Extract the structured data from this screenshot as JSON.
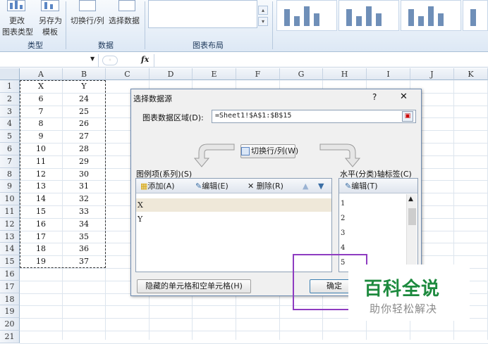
{
  "ribbon": {
    "type_group": {
      "label": "类型",
      "change_type_line1": "更改",
      "change_type_line2": "图表类型",
      "save_template_line1": "另存为",
      "save_template_line2": "模板"
    },
    "data_group": {
      "label": "数据",
      "switch_row_col": "切换行/列",
      "select_data": "选择数据"
    },
    "layout_group": {
      "label": "图表布局"
    }
  },
  "formula_bar": {
    "name_box_value": "",
    "fx": "fx",
    "formula_value": ""
  },
  "grid": {
    "columns": [
      "A",
      "B",
      "C",
      "D",
      "E",
      "F",
      "G",
      "H",
      "I",
      "J",
      "K"
    ],
    "rows": [
      "1",
      "2",
      "3",
      "4",
      "5",
      "6",
      "7",
      "8",
      "9",
      "10",
      "11",
      "12",
      "13",
      "14",
      "15",
      "16",
      "17",
      "18",
      "19",
      "20",
      "21"
    ],
    "col_a": [
      "X",
      "6",
      "7",
      "8",
      "9",
      "10",
      "11",
      "12",
      "13",
      "14",
      "15",
      "16",
      "17",
      "18",
      "19"
    ],
    "col_b": [
      "Y",
      "24",
      "25",
      "26",
      "27",
      "28",
      "29",
      "30",
      "31",
      "32",
      "33",
      "34",
      "35",
      "36",
      "37"
    ]
  },
  "dialog": {
    "title": "选择数据源",
    "help": "?",
    "close": "✕",
    "range_label": "图表数据区域(D):",
    "range_value": "=Sheet1!$A$1:$B$15",
    "switch_button": "切换行/列(W)",
    "series_label": "图例项(系列)(S)",
    "add_button": "添加(A)",
    "edit_button": "编辑(E)",
    "delete_button": "删除(R)",
    "series_items": [
      "X",
      "Y"
    ],
    "axis_label": "水平(分类)轴标签(C)",
    "axis_edit_button": "编辑(T)",
    "axis_items": [
      "1",
      "2",
      "3",
      "4",
      "5"
    ],
    "hidden_cells_button": "隐藏的单元格和空单元格(H)",
    "ok_button": "确定"
  },
  "watermark": {
    "title": "百科全说",
    "subtitle": "助你轻松解决",
    "title_color": "#1d8a3e"
  }
}
